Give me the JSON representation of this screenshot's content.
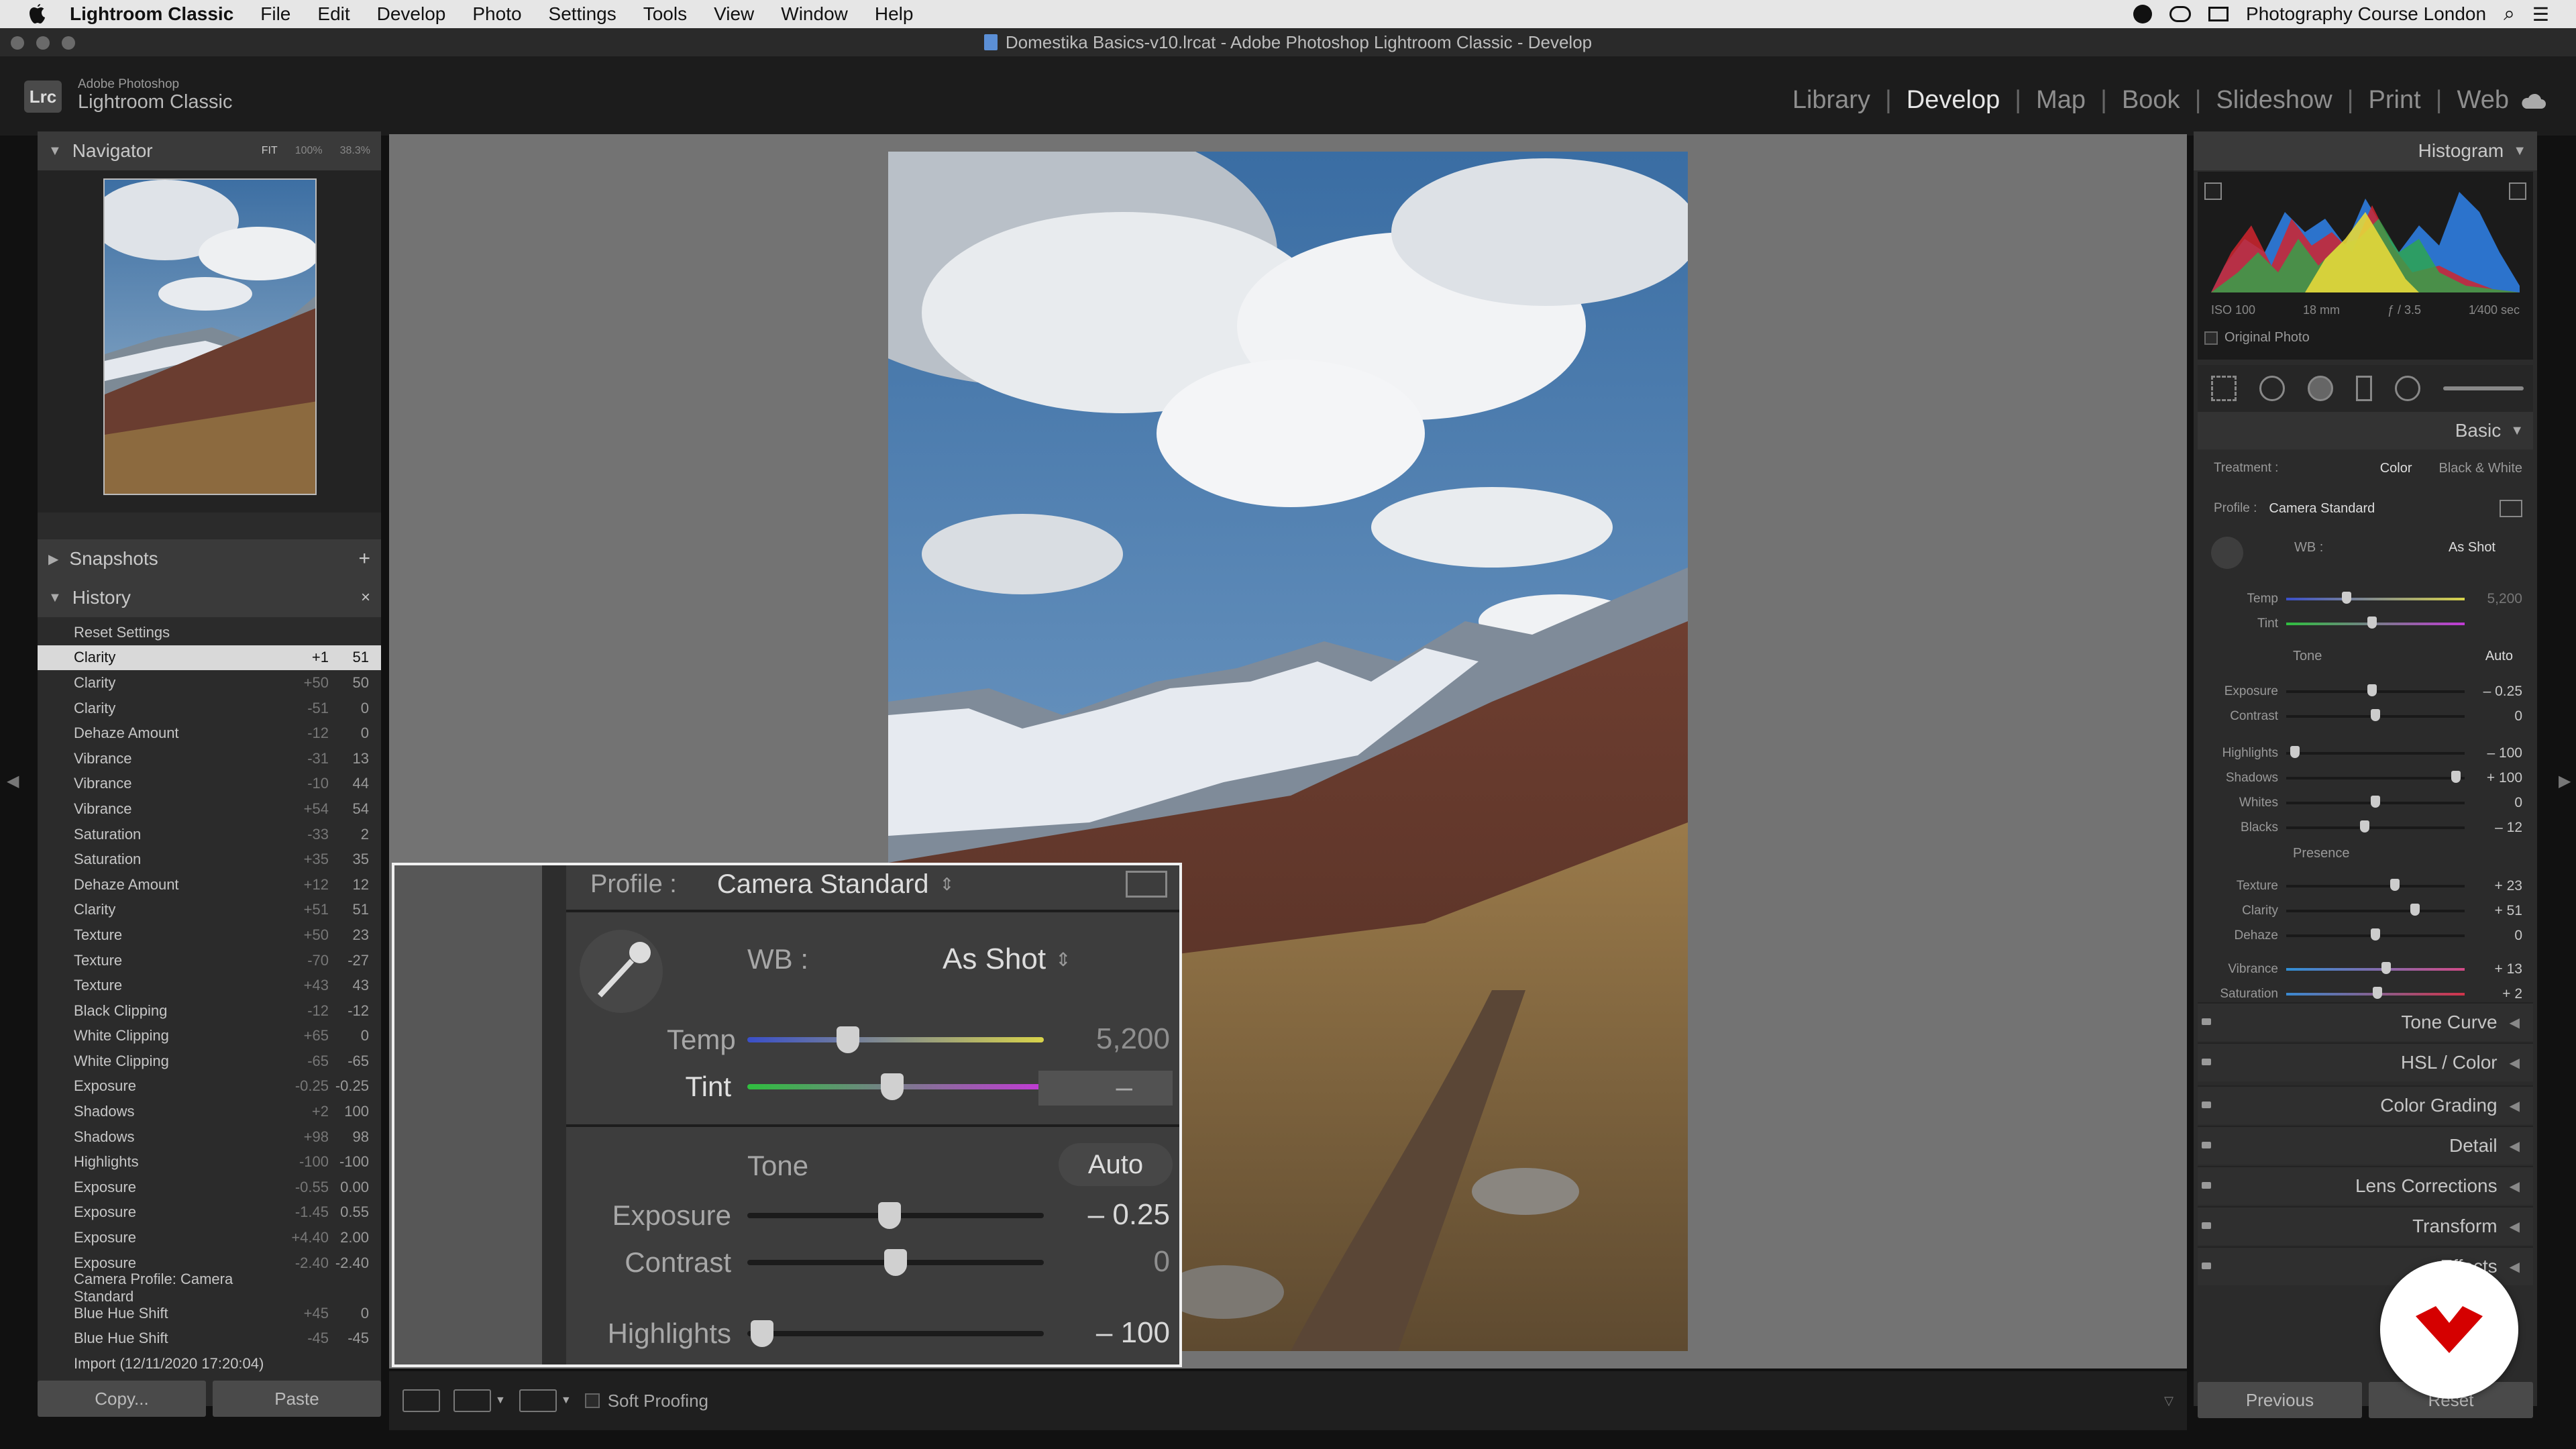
{
  "menubar": {
    "app_name": "Lightroom Classic",
    "items": [
      "File",
      "Edit",
      "Develop",
      "Photo",
      "Settings",
      "Tools",
      "View",
      "Window",
      "Help"
    ],
    "right_title": "Photography Course London"
  },
  "window": {
    "title": "Domestika Basics-v10.lrcat - Adobe Photoshop Lightroom Classic - Develop"
  },
  "identity": {
    "badge": "Lrc",
    "line1": "Adobe Photoshop",
    "line2": "Lightroom Classic"
  },
  "modules": [
    "Library",
    "Develop",
    "Map",
    "Book",
    "Slideshow",
    "Print",
    "Web"
  ],
  "active_module": "Develop",
  "navigator": {
    "title": "Navigator",
    "fit": "FIT",
    "z100": "100%",
    "z383": "38.3%"
  },
  "snapshots": {
    "title": "Snapshots"
  },
  "history": {
    "title": "History",
    "items": [
      {
        "name": "Reset Settings",
        "a": "",
        "b": ""
      },
      {
        "name": "Clarity",
        "a": "+1",
        "b": "51"
      },
      {
        "name": "Clarity",
        "a": "+50",
        "b": "50"
      },
      {
        "name": "Clarity",
        "a": "-51",
        "b": "0"
      },
      {
        "name": "Dehaze Amount",
        "a": "-12",
        "b": "0"
      },
      {
        "name": "Vibrance",
        "a": "-31",
        "b": "13"
      },
      {
        "name": "Vibrance",
        "a": "-10",
        "b": "44"
      },
      {
        "name": "Vibrance",
        "a": "+54",
        "b": "54"
      },
      {
        "name": "Saturation",
        "a": "-33",
        "b": "2"
      },
      {
        "name": "Saturation",
        "a": "+35",
        "b": "35"
      },
      {
        "name": "Dehaze Amount",
        "a": "+12",
        "b": "12"
      },
      {
        "name": "Clarity",
        "a": "+51",
        "b": "51"
      },
      {
        "name": "Texture",
        "a": "+50",
        "b": "23"
      },
      {
        "name": "Texture",
        "a": "-70",
        "b": "-27"
      },
      {
        "name": "Texture",
        "a": "+43",
        "b": "43"
      },
      {
        "name": "Black Clipping",
        "a": "-12",
        "b": "-12"
      },
      {
        "name": "White Clipping",
        "a": "+65",
        "b": "0"
      },
      {
        "name": "White Clipping",
        "a": "-65",
        "b": "-65"
      },
      {
        "name": "Exposure",
        "a": "-0.25",
        "b": "-0.25"
      },
      {
        "name": "Shadows",
        "a": "+2",
        "b": "100"
      },
      {
        "name": "Shadows",
        "a": "+98",
        "b": "98"
      },
      {
        "name": "Highlights",
        "a": "-100",
        "b": "-100"
      },
      {
        "name": "Exposure",
        "a": "-0.55",
        "b": "0.00"
      },
      {
        "name": "Exposure",
        "a": "-1.45",
        "b": "0.55"
      },
      {
        "name": "Exposure",
        "a": "+4.40",
        "b": "2.00"
      },
      {
        "name": "Exposure",
        "a": "-2.40",
        "b": "-2.40"
      },
      {
        "name": "Camera Profile: Camera Standard",
        "a": "",
        "b": ""
      },
      {
        "name": "Blue Hue Shift",
        "a": "+45",
        "b": "0"
      },
      {
        "name": "Blue Hue Shift",
        "a": "-45",
        "b": "-45"
      },
      {
        "name": "Import (12/11/2020 17:20:04)",
        "a": "",
        "b": ""
      }
    ]
  },
  "left_buttons": {
    "copy": "Copy...",
    "paste": "Paste"
  },
  "toolbar": {
    "soft_proofing": "Soft Proofing"
  },
  "right_buttons": {
    "previous": "Previous",
    "reset": "Reset"
  },
  "histogram": {
    "title": "Histogram",
    "iso": "ISO 100",
    "focal": "18 mm",
    "aperture": "ƒ / 3.5",
    "shutter": "1⁄400 sec",
    "original_photo": "Original Photo"
  },
  "basic": {
    "title": "Basic",
    "treatment_label": "Treatment :",
    "color": "Color",
    "bw": "Black & White",
    "profile_label": "Profile :",
    "profile_value": "Camera Standard",
    "wb_label": "WB :",
    "wb_value": "As Shot",
    "tone": "Tone",
    "auto": "Auto",
    "presence": "Presence",
    "sliders": [
      {
        "label": "Temp",
        "value": "5,200",
        "pos": 0.34
      },
      {
        "label": "Tint",
        "value": "",
        "pos": 0.48
      },
      {
        "label": "Exposure",
        "value": "– 0.25",
        "pos": 0.48
      },
      {
        "label": "Contrast",
        "value": "0",
        "pos": 0.5
      },
      {
        "label": "Highlights",
        "value": "– 100",
        "pos": 0.05
      },
      {
        "label": "Shadows",
        "value": "+ 100",
        "pos": 0.95
      },
      {
        "label": "Whites",
        "value": "0",
        "pos": 0.5
      },
      {
        "label": "Blacks",
        "value": "– 12",
        "pos": 0.44
      },
      {
        "label": "Texture",
        "value": "+ 23",
        "pos": 0.61
      },
      {
        "label": "Clarity",
        "value": "+ 51",
        "pos": 0.72
      },
      {
        "label": "Dehaze",
        "value": "0",
        "pos": 0.5
      },
      {
        "label": "Vibrance",
        "value": "+ 13",
        "pos": 0.56
      },
      {
        "label": "Saturation",
        "value": "+ 2",
        "pos": 0.51
      }
    ]
  },
  "sections": [
    "Tone Curve",
    "HSL / Color",
    "Color Grading",
    "Detail",
    "Lens Corrections",
    "Transform",
    "Effects"
  ],
  "zoom": {
    "profile_label": "Profile :",
    "profile_value": "Camera Standard",
    "wb_label": "WB :",
    "wb_value": "As Shot",
    "temp_label": "Temp",
    "temp_value": "5,200",
    "tint_label": "Tint",
    "tint_value": "–",
    "tone": "Tone",
    "auto": "Auto",
    "exposure_label": "Exposure",
    "exposure_value": "– 0.25",
    "contrast_label": "Contrast",
    "contrast_value": "0",
    "highlights_label": "Highlights",
    "highlights_value": "– 100"
  },
  "colors": {
    "accent_active": "#e6e6e6",
    "panel": "#2b2b2b",
    "selection": "#d9d9d9",
    "brand_badge": "#d50000"
  }
}
